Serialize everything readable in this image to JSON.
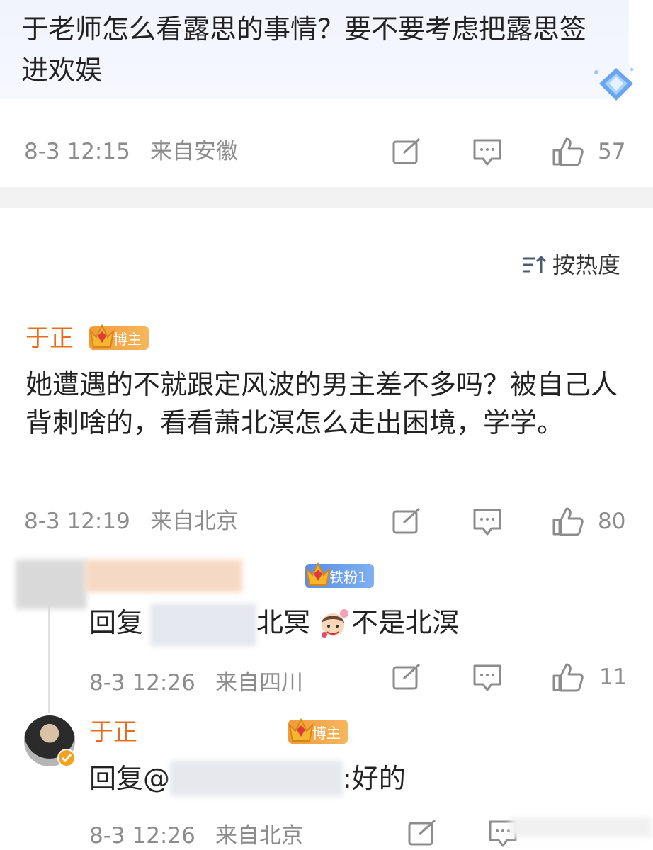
{
  "quoted_post": {
    "text": "于老师怎么看露思的事情？要不要考虑把露思签进欢娱",
    "time": "8-3 12:15",
    "location": "来自安徽",
    "likes": "57"
  },
  "sort": {
    "label": "按热度"
  },
  "comment": {
    "author": "于正",
    "badge": "博主",
    "text": "她遭遇的不就跟定风波的男主差不多吗？被自己人背刺啥的，看看萧北溟怎么走出困境，学学。",
    "time": "8-3 12:19",
    "location": "来自北京",
    "likes": "80"
  },
  "reply1": {
    "badge": "铁粉1",
    "text_prefix": "回复",
    "text_suffix_a": "北冥",
    "text_suffix_b": "不是北溟",
    "time": "8-3 12:26",
    "location": "来自四川",
    "likes": "11"
  },
  "reply2": {
    "author": "于正",
    "badge": "博主",
    "text_prefix": "回复@",
    "text_suffix": ":好的",
    "time": "8-3 12:26",
    "location": "来自北京"
  },
  "colors": {
    "username": "#e86c1f",
    "meta": "#8c8c8c",
    "badge_blogger": "#f29a3a",
    "badge_fan": "#5a8de6"
  },
  "icons": [
    "share-icon",
    "comment-icon",
    "like-icon",
    "sort-icon",
    "crown-icon",
    "diamond-icon",
    "verified-icon"
  ]
}
